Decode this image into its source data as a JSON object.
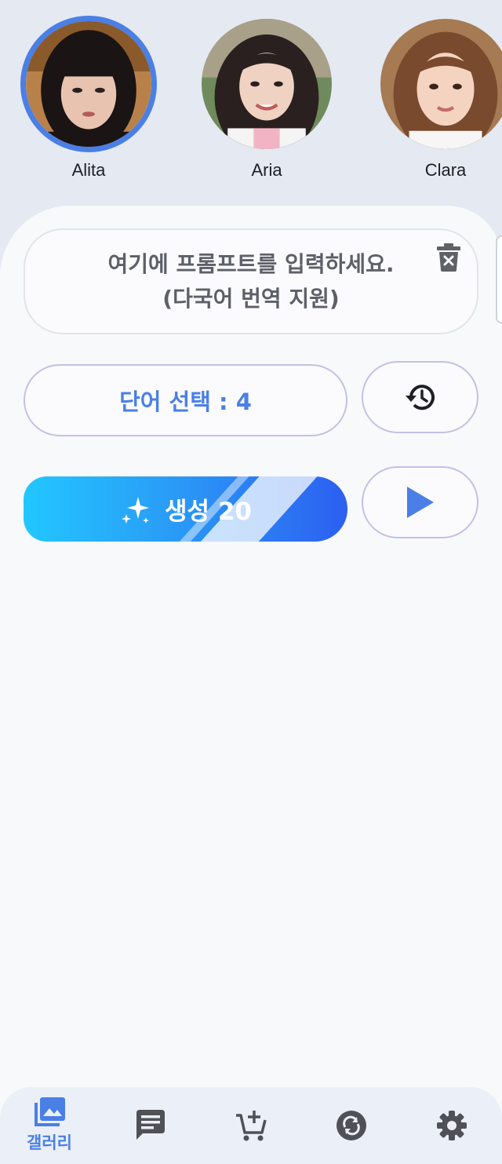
{
  "characters": [
    {
      "name": "Alita",
      "selected": true
    },
    {
      "name": "Aria",
      "selected": false
    },
    {
      "name": "Clara",
      "selected": false
    }
  ],
  "prompt": {
    "placeholder": "여기에 프롬프트를 입력하세요.\n(다국어 번역 지원)"
  },
  "word_select": {
    "label": "단어 선택 : 4"
  },
  "generate": {
    "label": "생성 20"
  },
  "nav": {
    "items": [
      {
        "icon": "gallery-icon",
        "label": "갤러리",
        "active": true
      },
      {
        "icon": "chat-icon",
        "label": "",
        "active": false
      },
      {
        "icon": "cart-add-icon",
        "label": "",
        "active": false
      },
      {
        "icon": "sync-icon",
        "label": "",
        "active": false
      },
      {
        "icon": "settings-icon",
        "label": "",
        "active": false
      }
    ]
  },
  "colors": {
    "accent": "#4a7fe6",
    "background": "#e4e9f2",
    "sheet": "#f8f9fb",
    "gradient_start": "#22c7ff",
    "gradient_end": "#2c5ff1"
  }
}
